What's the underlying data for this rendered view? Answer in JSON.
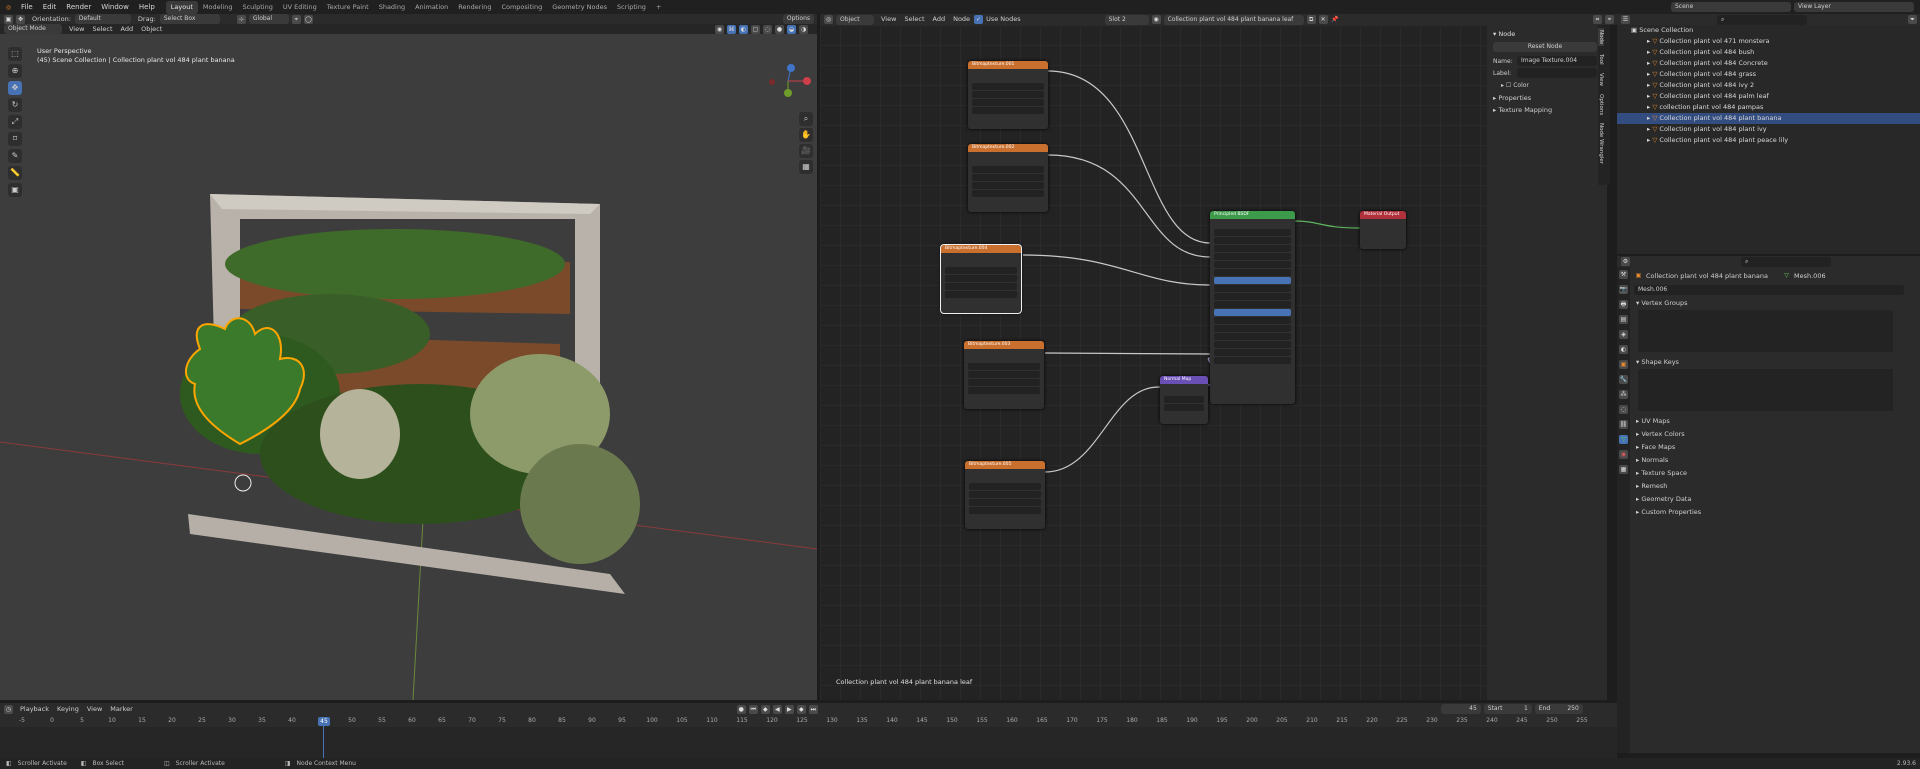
{
  "topbar": {
    "menus": [
      "File",
      "Edit",
      "Render",
      "Window",
      "Help"
    ],
    "workspaces": [
      "Layout",
      "Modeling",
      "Sculpting",
      "UV Editing",
      "Texture Paint",
      "Shading",
      "Animation",
      "Rendering",
      "Compositing",
      "Geometry Nodes",
      "Scripting"
    ],
    "active_workspace": "Layout",
    "scene": "Scene",
    "view_layer": "View Layer"
  },
  "viewport": {
    "header": {
      "orientation_label": "Orientation:",
      "orientation_value": "Default",
      "drag_label": "Drag:",
      "drag_value": "Select Box",
      "transform": "Global",
      "options": "Options",
      "mode": "Object Mode",
      "menus": [
        "View",
        "Select",
        "Add",
        "Object"
      ]
    },
    "info_line1": "User Perspective",
    "info_line2": "(45) Scene Collection | Collection plant vol 484 plant banana"
  },
  "node_editor": {
    "header": {
      "object": "Object",
      "menus": [
        "View",
        "Select",
        "Add",
        "Node"
      ],
      "use_nodes": "Use Nodes",
      "slot": "Slot 2",
      "material": "Collection plant vol 484 plant banana leaf"
    },
    "footer_label": "Collection plant vol 484 plant banana leaf",
    "nodes": [
      {
        "title": "Bitmaptexture.001",
        "type": "image"
      },
      {
        "title": "Bitmaptexture.002",
        "type": "image"
      },
      {
        "title": "Bitmaptexture.004",
        "type": "image"
      },
      {
        "title": "Bitmaptexture.003",
        "type": "image"
      },
      {
        "title": "Bitmaptexture.005",
        "type": "image"
      },
      {
        "title": "Principled BSDF",
        "type": "bsdf"
      },
      {
        "title": "Material Output",
        "type": "output"
      },
      {
        "title": "Normal Map",
        "type": "normal"
      }
    ]
  },
  "npanel": {
    "section": "Node",
    "reset_button": "Reset Node",
    "name_label": "Name:",
    "name_value": "Image Texture.004",
    "label_label": "Label:",
    "color_label": "Color",
    "properties_label": "Properties",
    "texture_mapping_label": "Texture Mapping",
    "tabs": [
      "Node",
      "Tool",
      "View",
      "Options",
      "Node Wrangler"
    ]
  },
  "outliner": {
    "root": "Scene Collection",
    "items": [
      "Collection plant vol 471 monstera",
      "Collection plant vol 484 bush",
      "Collection plant vol 484 Concrete",
      "Collection plant vol 484 grass",
      "Collection plant vol 484 ivy 2",
      "Collection plant vol 484 palm leaf",
      "collection plant vol 484 pampas",
      "Collection plant vol 484 plant banana",
      "Collection plant vol 484 plant ivy",
      "Collection plant vol 484 plant peace lily"
    ],
    "selected_index": 7
  },
  "properties": {
    "object_name": "Collection plant vol 484 plant banana",
    "mesh_name": "Mesh.006",
    "data_name": "Mesh.006",
    "sections_open": [
      "Vertex Groups",
      "Shape Keys"
    ],
    "sections_closed": [
      "UV Maps",
      "Vertex Colors",
      "Face Maps",
      "Normals",
      "Texture Space",
      "Remesh",
      "Geometry Data",
      "Custom Properties"
    ]
  },
  "timeline": {
    "menus": [
      "Playback",
      "Keying",
      "View",
      "Marker"
    ],
    "current_frame": "45",
    "start_label": "Start",
    "start_value": "1",
    "end_label": "End",
    "end_value": "250",
    "ticks": [
      "-5",
      "0",
      "5",
      "10",
      "15",
      "20",
      "25",
      "30",
      "35",
      "40",
      "45",
      "50",
      "55",
      "60",
      "65",
      "70",
      "75",
      "80",
      "85",
      "90",
      "95",
      "100",
      "105",
      "110",
      "115",
      "120",
      "125",
      "130",
      "135",
      "140",
      "145",
      "150",
      "155",
      "160",
      "165",
      "170",
      "175",
      "180",
      "185",
      "190",
      "195",
      "200",
      "205",
      "210",
      "215",
      "220",
      "225",
      "230",
      "235",
      "240",
      "245",
      "250",
      "255"
    ]
  },
  "status": {
    "left1": "Scroller Activate",
    "left2": "Box Select",
    "left3": "Scroller Activate",
    "left4": "Node Context Menu",
    "version": "2.93.6"
  },
  "colors": {
    "accent": "#4772b3",
    "selection_outline": "#ffa500",
    "image_node_header": "#c9702e",
    "bsdf_node_header": "#3c9a4a",
    "output_node_header": "#b0313b",
    "normal_node_header": "#6a4fb5"
  }
}
